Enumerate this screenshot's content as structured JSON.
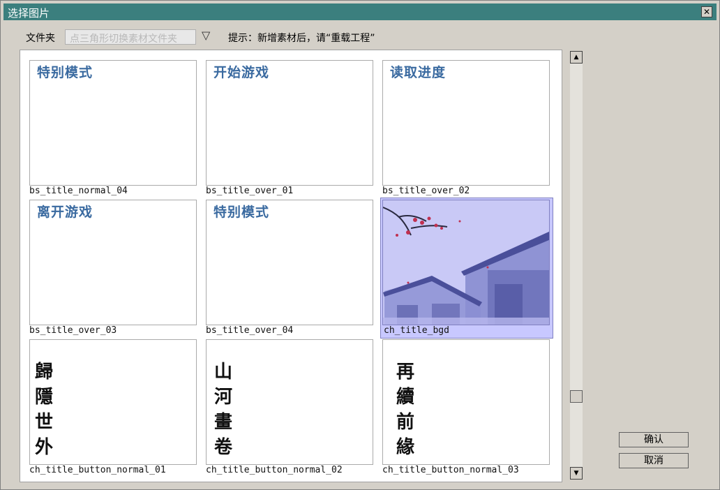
{
  "window": {
    "title": "选择图片",
    "close_glyph": "✕"
  },
  "folder": {
    "label": "文件夹",
    "placeholder": "点三角形切换素材文件夹",
    "toggle_glyph": "▽",
    "hint": "提示：新增素材后，请“重载工程”"
  },
  "items": [
    {
      "caption": "bs_title_normal_04",
      "thumb_text": "特别模式"
    },
    {
      "caption": "bs_title_over_01",
      "thumb_text": "开始游戏"
    },
    {
      "caption": "bs_title_over_02",
      "thumb_text": "读取进度"
    },
    {
      "caption": "bs_title_over_03",
      "thumb_text": "离开游戏"
    },
    {
      "caption": "bs_title_over_04",
      "thumb_text": "特别模式"
    },
    {
      "caption": "ch_title_bgd",
      "selected": true
    },
    {
      "caption": "ch_title_button_normal_01",
      "thumb_text": "歸\n隱\n世\n外"
    },
    {
      "caption": "ch_title_button_normal_02",
      "thumb_text": "山\n河\n畫\n卷"
    },
    {
      "caption": "ch_title_button_normal_03",
      "thumb_text": "再\n續\n前\n緣"
    }
  ],
  "scrollbar": {
    "up_glyph": "▲",
    "down_glyph": "▼"
  },
  "buttons": {
    "ok": "确认",
    "cancel": "取消"
  },
  "colors": {
    "titlebar": "#3b7f7e",
    "menu_text": "#3a6aa0",
    "selection": "#c8c8ff"
  }
}
